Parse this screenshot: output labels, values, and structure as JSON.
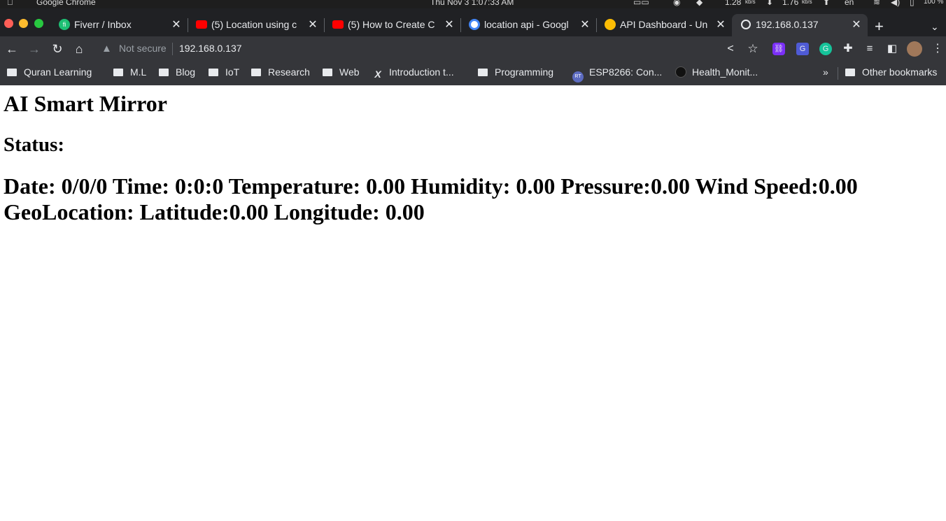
{
  "system_bar": {
    "app_name": "Google Chrome",
    "datetime": "Thu Nov 3   1:07:33 AM",
    "net_down": "1.28",
    "net_down_unit": "kb/s",
    "net_up": "1.76",
    "net_up_unit": "kb/s",
    "lang": "en",
    "battery": "100 %"
  },
  "tabs": [
    {
      "title": "Fiverr / Inbox",
      "icon": "fiverr-icon",
      "color": "#1dbf73"
    },
    {
      "title": "(5) Location using c",
      "icon": "youtube-icon",
      "color": "#ff0000"
    },
    {
      "title": "(5) How to Create C",
      "icon": "youtube-icon",
      "color": "#ff0000"
    },
    {
      "title": "location api - Googl",
      "icon": "google-icon",
      "color": "#4285f4"
    },
    {
      "title": "API Dashboard - Un",
      "icon": "lightbulb-icon",
      "color": "#fbbc04"
    },
    {
      "title": "192.168.0.137",
      "icon": "globe-icon",
      "color": "#e8eaed",
      "active": true
    }
  ],
  "omnibox": {
    "security": "Not secure",
    "url": "192.168.0.137"
  },
  "bookmarks": [
    {
      "label": "Quran Learning",
      "icon": "folder-icon"
    },
    {
      "label": "M.L",
      "icon": "folder-icon"
    },
    {
      "label": "Blog",
      "icon": "folder-icon"
    },
    {
      "label": "IoT",
      "icon": "folder-icon"
    },
    {
      "label": "Research",
      "icon": "folder-icon"
    },
    {
      "label": "Web",
      "icon": "folder-icon"
    },
    {
      "label": "Introduction t...",
      "icon": "x-icon"
    },
    {
      "label": "Programming",
      "icon": "folder-icon"
    },
    {
      "label": "ESP8266: Con...",
      "icon": "rt-icon"
    },
    {
      "label": "Health_Monit...",
      "icon": "github-icon"
    }
  ],
  "bookmarks_overflow": "»",
  "other_bookmarks": "Other bookmarks",
  "page": {
    "title": "AI Smart Mirror",
    "status_label": "Status:",
    "date_label": "Date:",
    "date": "0/0/0",
    "time_label": "Time:",
    "time": "0:0:0",
    "temperature_label": "Temperature:",
    "temperature": "0.00",
    "humidity_label": "Humidity:",
    "humidity": "0.00",
    "pressure_label": "Pressure:",
    "pressure": "0.00",
    "wind_label": "Wind Speed:",
    "wind": "0.00",
    "geo_label": "GeoLocation:",
    "lat_label": "Latitude:",
    "lat": "0.00",
    "lon_label": "Longitude:",
    "lon": "0.00"
  }
}
